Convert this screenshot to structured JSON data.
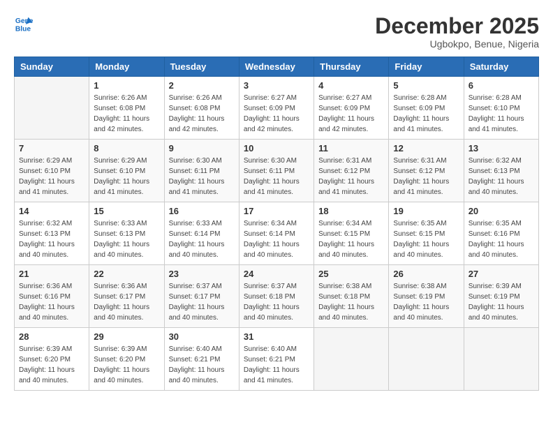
{
  "logo": {
    "line1": "General",
    "line2": "Blue"
  },
  "title": "December 2025",
  "subtitle": "Ugbokpo, Benue, Nigeria",
  "weekdays": [
    "Sunday",
    "Monday",
    "Tuesday",
    "Wednesday",
    "Thursday",
    "Friday",
    "Saturday"
  ],
  "weeks": [
    [
      {
        "day": "",
        "info": ""
      },
      {
        "day": "1",
        "info": "Sunrise: 6:26 AM\nSunset: 6:08 PM\nDaylight: 11 hours and 42 minutes."
      },
      {
        "day": "2",
        "info": "Sunrise: 6:26 AM\nSunset: 6:08 PM\nDaylight: 11 hours and 42 minutes."
      },
      {
        "day": "3",
        "info": "Sunrise: 6:27 AM\nSunset: 6:09 PM\nDaylight: 11 hours and 42 minutes."
      },
      {
        "day": "4",
        "info": "Sunrise: 6:27 AM\nSunset: 6:09 PM\nDaylight: 11 hours and 42 minutes."
      },
      {
        "day": "5",
        "info": "Sunrise: 6:28 AM\nSunset: 6:09 PM\nDaylight: 11 hours and 41 minutes."
      },
      {
        "day": "6",
        "info": "Sunrise: 6:28 AM\nSunset: 6:10 PM\nDaylight: 11 hours and 41 minutes."
      }
    ],
    [
      {
        "day": "7",
        "info": "Sunrise: 6:29 AM\nSunset: 6:10 PM\nDaylight: 11 hours and 41 minutes."
      },
      {
        "day": "8",
        "info": "Sunrise: 6:29 AM\nSunset: 6:10 PM\nDaylight: 11 hours and 41 minutes."
      },
      {
        "day": "9",
        "info": "Sunrise: 6:30 AM\nSunset: 6:11 PM\nDaylight: 11 hours and 41 minutes."
      },
      {
        "day": "10",
        "info": "Sunrise: 6:30 AM\nSunset: 6:11 PM\nDaylight: 11 hours and 41 minutes."
      },
      {
        "day": "11",
        "info": "Sunrise: 6:31 AM\nSunset: 6:12 PM\nDaylight: 11 hours and 41 minutes."
      },
      {
        "day": "12",
        "info": "Sunrise: 6:31 AM\nSunset: 6:12 PM\nDaylight: 11 hours and 41 minutes."
      },
      {
        "day": "13",
        "info": "Sunrise: 6:32 AM\nSunset: 6:13 PM\nDaylight: 11 hours and 40 minutes."
      }
    ],
    [
      {
        "day": "14",
        "info": "Sunrise: 6:32 AM\nSunset: 6:13 PM\nDaylight: 11 hours and 40 minutes."
      },
      {
        "day": "15",
        "info": "Sunrise: 6:33 AM\nSunset: 6:13 PM\nDaylight: 11 hours and 40 minutes."
      },
      {
        "day": "16",
        "info": "Sunrise: 6:33 AM\nSunset: 6:14 PM\nDaylight: 11 hours and 40 minutes."
      },
      {
        "day": "17",
        "info": "Sunrise: 6:34 AM\nSunset: 6:14 PM\nDaylight: 11 hours and 40 minutes."
      },
      {
        "day": "18",
        "info": "Sunrise: 6:34 AM\nSunset: 6:15 PM\nDaylight: 11 hours and 40 minutes."
      },
      {
        "day": "19",
        "info": "Sunrise: 6:35 AM\nSunset: 6:15 PM\nDaylight: 11 hours and 40 minutes."
      },
      {
        "day": "20",
        "info": "Sunrise: 6:35 AM\nSunset: 6:16 PM\nDaylight: 11 hours and 40 minutes."
      }
    ],
    [
      {
        "day": "21",
        "info": "Sunrise: 6:36 AM\nSunset: 6:16 PM\nDaylight: 11 hours and 40 minutes."
      },
      {
        "day": "22",
        "info": "Sunrise: 6:36 AM\nSunset: 6:17 PM\nDaylight: 11 hours and 40 minutes."
      },
      {
        "day": "23",
        "info": "Sunrise: 6:37 AM\nSunset: 6:17 PM\nDaylight: 11 hours and 40 minutes."
      },
      {
        "day": "24",
        "info": "Sunrise: 6:37 AM\nSunset: 6:18 PM\nDaylight: 11 hours and 40 minutes."
      },
      {
        "day": "25",
        "info": "Sunrise: 6:38 AM\nSunset: 6:18 PM\nDaylight: 11 hours and 40 minutes."
      },
      {
        "day": "26",
        "info": "Sunrise: 6:38 AM\nSunset: 6:19 PM\nDaylight: 11 hours and 40 minutes."
      },
      {
        "day": "27",
        "info": "Sunrise: 6:39 AM\nSunset: 6:19 PM\nDaylight: 11 hours and 40 minutes."
      }
    ],
    [
      {
        "day": "28",
        "info": "Sunrise: 6:39 AM\nSunset: 6:20 PM\nDaylight: 11 hours and 40 minutes."
      },
      {
        "day": "29",
        "info": "Sunrise: 6:39 AM\nSunset: 6:20 PM\nDaylight: 11 hours and 40 minutes."
      },
      {
        "day": "30",
        "info": "Sunrise: 6:40 AM\nSunset: 6:21 PM\nDaylight: 11 hours and 40 minutes."
      },
      {
        "day": "31",
        "info": "Sunrise: 6:40 AM\nSunset: 6:21 PM\nDaylight: 11 hours and 41 minutes."
      },
      {
        "day": "",
        "info": ""
      },
      {
        "day": "",
        "info": ""
      },
      {
        "day": "",
        "info": ""
      }
    ]
  ]
}
